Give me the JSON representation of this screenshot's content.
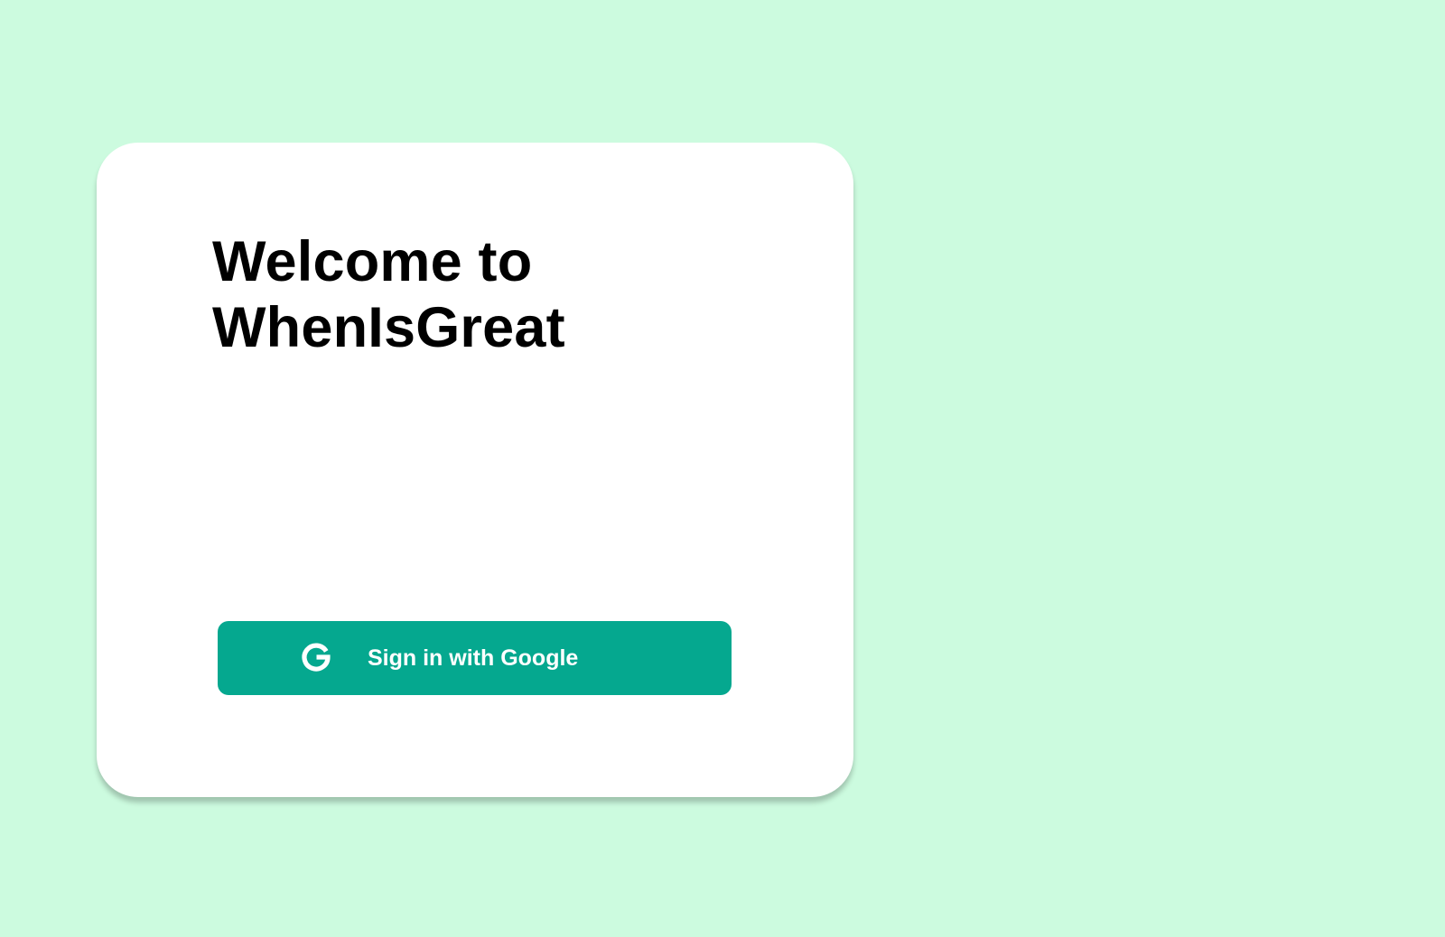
{
  "page": {
    "background_color": "#ccfbdf"
  },
  "card": {
    "background_color": "#ffffff",
    "title_line1": "Welcome to",
    "title_line2": "WhenIsGreat"
  },
  "sign_in_button": {
    "label": "Sign in with Google",
    "icon": "google-icon",
    "background_color": "#05a88f",
    "text_color": "#ffffff"
  }
}
